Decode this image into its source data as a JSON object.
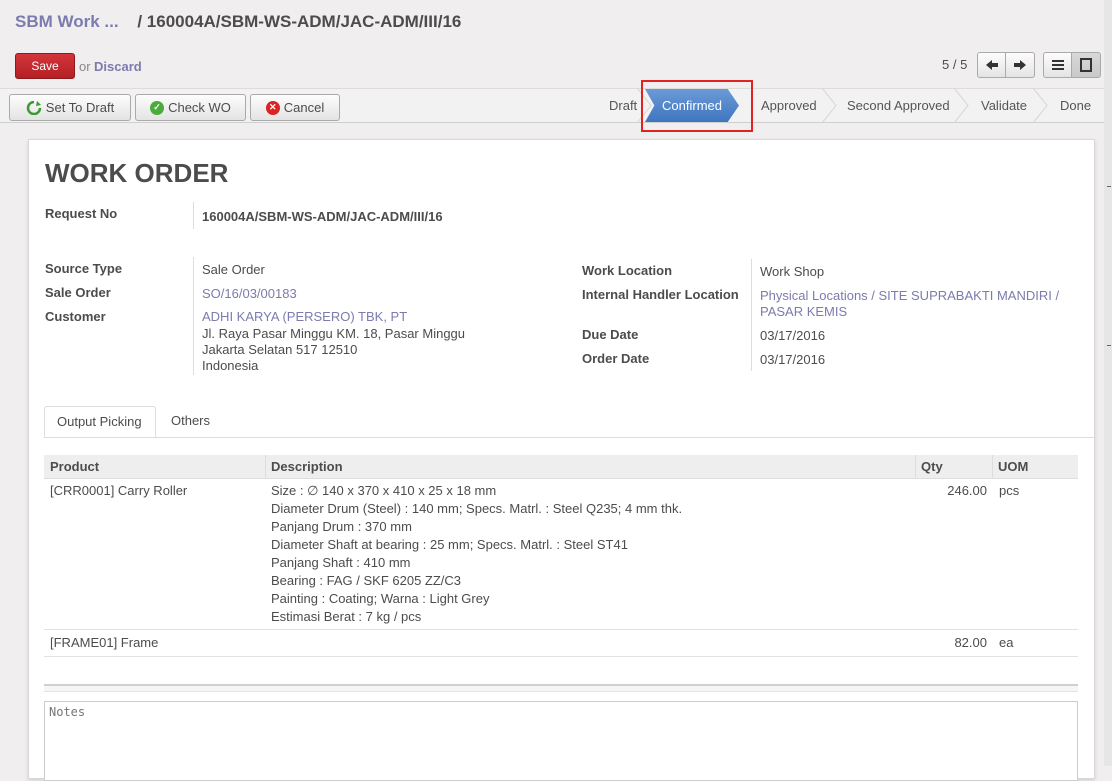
{
  "breadcrumb": {
    "parent": "SBM Work ...",
    "separator": "/",
    "current": "160004A/SBM-WS-ADM/JAC-ADM/III/16"
  },
  "toolbar": {
    "save_label": "Save",
    "or_text": "or",
    "discard_label": "Discard",
    "pager": "5 / 5"
  },
  "actions": {
    "set_to_draft": "Set To Draft",
    "check_wo": "Check WO",
    "cancel": "Cancel"
  },
  "status": {
    "stages": [
      "Draft",
      "Confirmed",
      "Approved",
      "Second Approved",
      "Validate",
      "Done"
    ],
    "current": "Confirmed",
    "active_color": "#4a80c8",
    "highlight_color": "#e02222"
  },
  "form": {
    "title": "WORK ORDER",
    "request_no_label": "Request No",
    "request_no": "160004A/SBM-WS-ADM/JAC-ADM/III/16",
    "source_type_label": "Source Type",
    "source_type": "Sale Order",
    "sale_order_label": "Sale Order",
    "sale_order": "SO/16/03/00183",
    "customer_label": "Customer",
    "customer_name": "ADHI KARYA (PERSERO) TBK, PT",
    "customer_address": [
      "Jl. Raya Pasar Minggu KM. 18, Pasar Minggu",
      "Jakarta Selatan 517 12510",
      "Indonesia"
    ],
    "work_location_label": "Work Location",
    "work_location": "Work Shop",
    "handler_location_label": "Internal Handler Location",
    "handler_location": [
      "Physical Locations / SITE SUPRABAKTI MANDIRI /",
      "PASAR KEMIS"
    ],
    "due_date_label": "Due Date",
    "due_date": "03/17/2016",
    "order_date_label": "Order Date",
    "order_date": "03/17/2016"
  },
  "tabs": [
    "Output Picking",
    "Others"
  ],
  "lines": {
    "headers": [
      "Product",
      "Description",
      "Qty",
      "UOM"
    ],
    "rows": [
      {
        "product": "[CRR0001] Carry Roller",
        "description": [
          "Size : ∅ 140 x 370 x 410 x 25 x 18 mm",
          "Diameter Drum (Steel) : 140 mm; Specs. Matrl. : Steel Q235; 4 mm thk.",
          "Panjang Drum : 370 mm",
          "Diameter Shaft at bearing : 25 mm; Specs. Matrl. : Steel ST41",
          "Panjang Shaft : 410 mm",
          "Bearing : FAG / SKF 6205 ZZ/C3",
          "Painting : Coating; Warna : Light Grey",
          "Estimasi Berat : 7 kg / pcs"
        ],
        "qty": "246.00",
        "uom": "pcs"
      },
      {
        "product": "[FRAME01] Frame",
        "description": [],
        "qty": "82.00",
        "uom": "ea"
      }
    ]
  },
  "notes": {
    "placeholder": "Notes"
  }
}
